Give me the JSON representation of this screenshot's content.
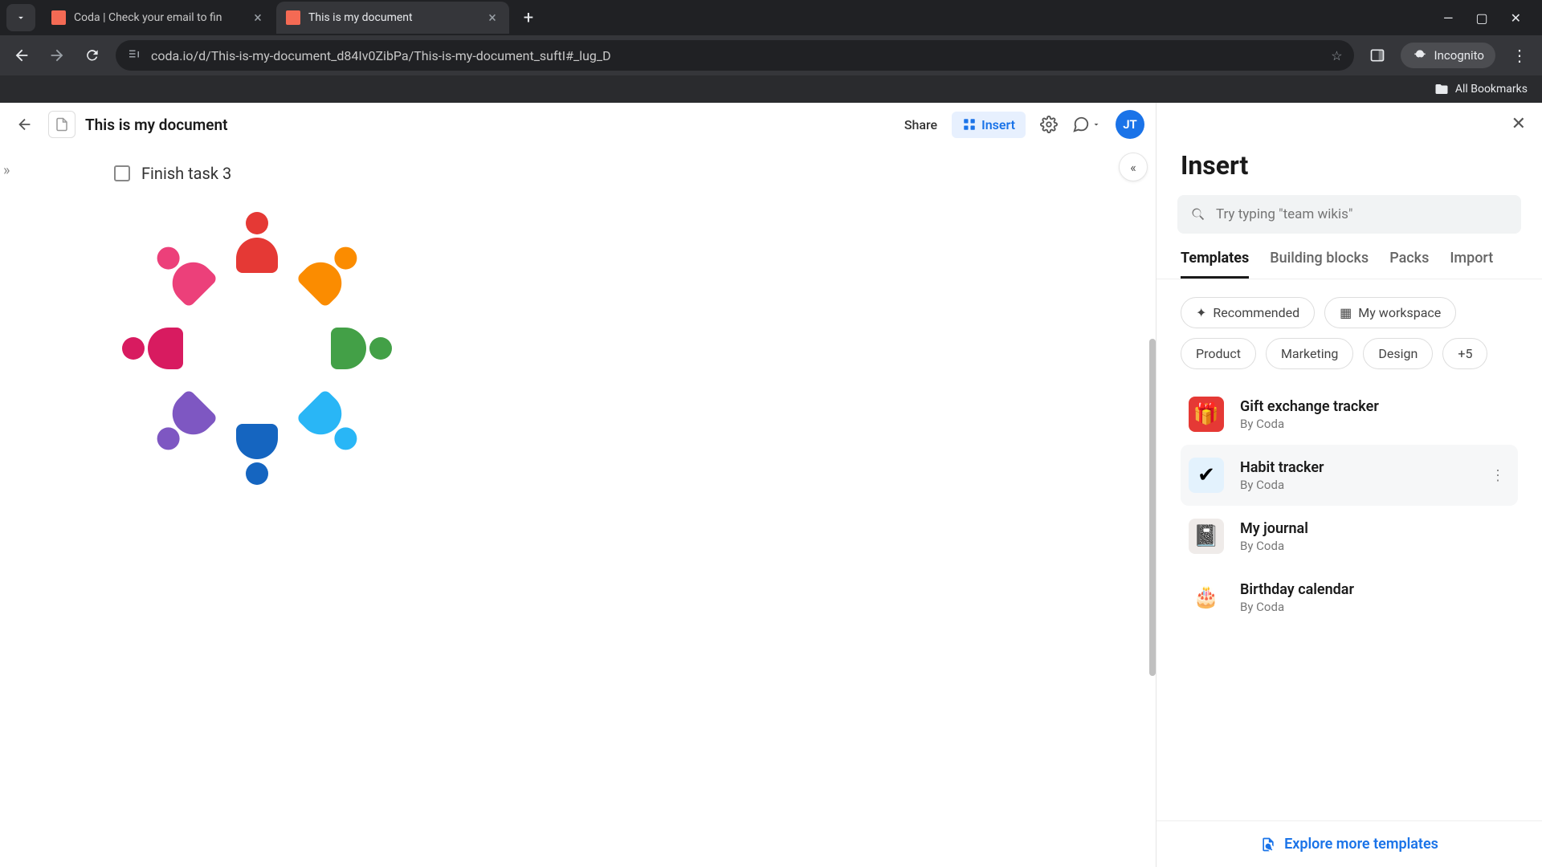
{
  "browser": {
    "tabs": [
      {
        "title": "Coda | Check your email to fin"
      },
      {
        "title": "This is my document"
      }
    ],
    "url": "coda.io/d/This-is-my-document_d84Iv0ZibPa/This-is-my-document_suftI#_lug_D",
    "incognito_label": "Incognito",
    "all_bookmarks": "All Bookmarks"
  },
  "doc": {
    "title": "This is my document",
    "share": "Share",
    "insert": "Insert",
    "avatar": "JT",
    "task": "Finish task 3"
  },
  "panel": {
    "title": "Insert",
    "search_placeholder": "Try typing \"team wikis\"",
    "tabs": [
      "Templates",
      "Building blocks",
      "Packs",
      "Import"
    ],
    "chips_row1": [
      {
        "label": "Recommended",
        "icon": "✦"
      },
      {
        "label": "My workspace",
        "icon": "▦"
      }
    ],
    "chips_row2": [
      "Product",
      "Marketing",
      "Design",
      "+5"
    ],
    "templates": [
      {
        "title": "Gift exchange tracker",
        "by": "By Coda",
        "emoji": "🎁",
        "bg": "#e53935"
      },
      {
        "title": "Habit tracker",
        "by": "By Coda",
        "emoji": "✔",
        "bg": "#e3f2fd",
        "hovered": true
      },
      {
        "title": "My journal",
        "by": "By Coda",
        "emoji": "📓",
        "bg": "#efebe9"
      },
      {
        "title": "Birthday calendar",
        "by": "By Coda",
        "emoji": "🎂",
        "bg": "#fff"
      }
    ],
    "explore": "Explore more templates"
  }
}
